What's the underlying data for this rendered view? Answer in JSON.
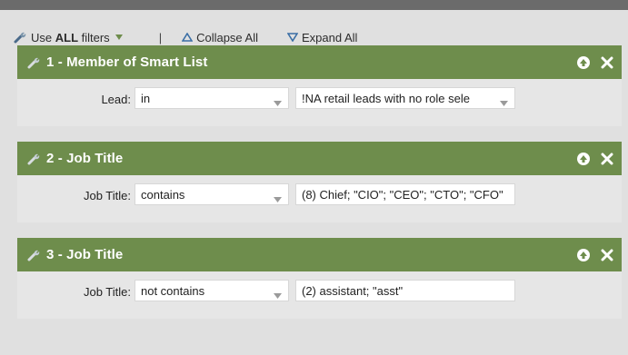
{
  "toolbar": {
    "use_prefix": "Use ",
    "use_bold": "ALL",
    "use_suffix": " filters",
    "separator": "|",
    "collapse_all": "Collapse All",
    "expand_all": "Expand All",
    "icons": {
      "filters": "wrench-icon",
      "collapse": "triangle-up-icon",
      "expand": "triangle-down-icon"
    }
  },
  "filters": [
    {
      "title": "1 - Member of Smart List",
      "label": "Lead:",
      "operator": "in",
      "value": "!NA retail leads with no role sele",
      "value_is_dropdown": true
    },
    {
      "title": "2 - Job Title",
      "label": "Job Title:",
      "operator": "contains",
      "value": "(8) Chief; \"CIO\"; \"CEO\"; \"CTO\"; \"CFO\"",
      "value_is_dropdown": false
    },
    {
      "title": "3 - Job Title",
      "label": "Job Title:",
      "operator": "not contains",
      "value": "(2) assistant; \"asst\"",
      "value_is_dropdown": false
    }
  ],
  "colors": {
    "header_green": "#6e8d4c",
    "panel": "#e0e0e0",
    "frame": "#6b6b6b",
    "accent_blue": "#3a6ea5"
  }
}
